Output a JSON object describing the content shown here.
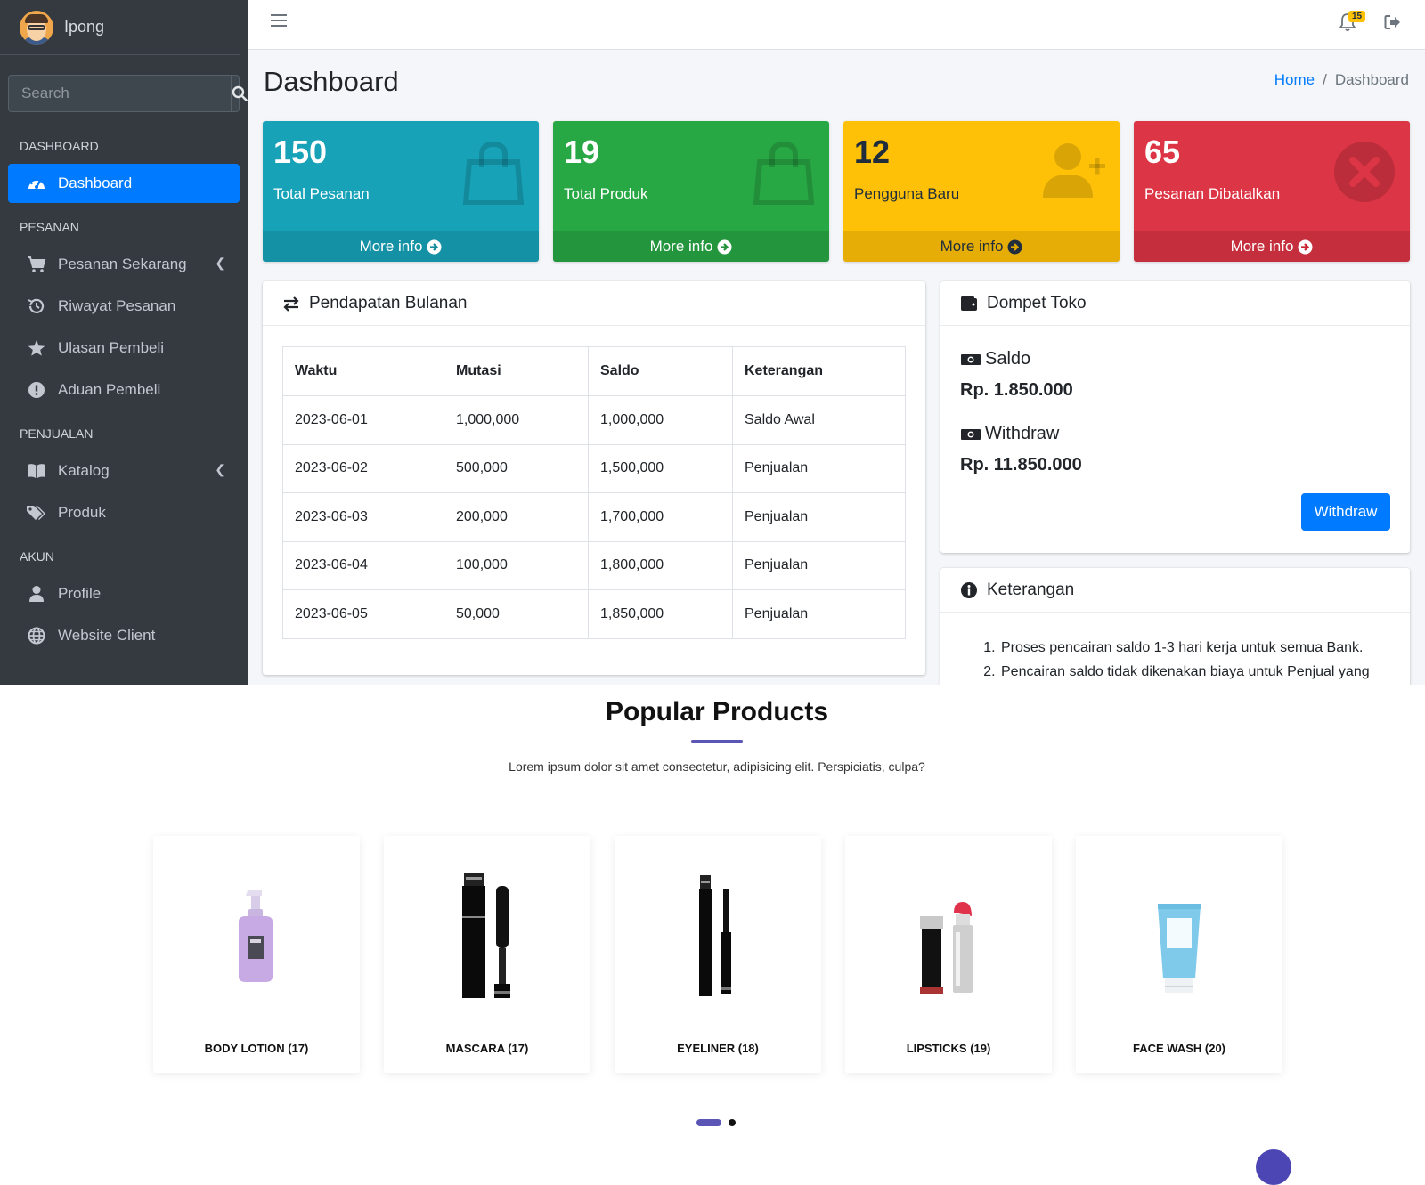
{
  "user": {
    "name": "Ipong"
  },
  "search": {
    "placeholder": "Search"
  },
  "sidebar": {
    "sections": [
      {
        "header": "DASHBOARD",
        "items": [
          {
            "label": "Dashboard",
            "icon": "tachometer-icon",
            "active": true
          }
        ]
      },
      {
        "header": "PESANAN",
        "items": [
          {
            "label": "Pesanan Sekarang",
            "icon": "cart-icon"
          },
          {
            "label": "Riwayat Pesanan",
            "icon": "history-icon"
          },
          {
            "label": "Ulasan Pembeli",
            "icon": "star-icon"
          },
          {
            "label": "Aduan Pembeli",
            "icon": "alert-icon"
          }
        ]
      },
      {
        "header": "PENJUALAN",
        "items": [
          {
            "label": "Katalog",
            "icon": "book-icon"
          },
          {
            "label": "Produk",
            "icon": "tags-icon"
          }
        ]
      },
      {
        "header": "AKUN",
        "items": [
          {
            "label": "Profile",
            "icon": "user-icon"
          },
          {
            "label": "Website Client",
            "icon": "globe-icon"
          }
        ]
      }
    ]
  },
  "topbar": {
    "notification_count": "15"
  },
  "page": {
    "title": "Dashboard"
  },
  "breadcrumb": {
    "home": "Home",
    "separator": "/",
    "current": "Dashboard"
  },
  "stats": [
    {
      "value": "150",
      "label": "Total Pesanan",
      "more": "More info",
      "color": "#17a2b8",
      "icon": "shopping-bag-icon"
    },
    {
      "value": "19",
      "label": "Total Produk",
      "more": "More info",
      "color": "#28a745",
      "icon": "shopping-bag-icon"
    },
    {
      "value": "12",
      "label": "Pengguna Baru",
      "more": "More info",
      "color": "#ffc107",
      "icon": "user-plus-icon"
    },
    {
      "value": "65",
      "label": "Pesanan Dibatalkan",
      "more": "More info",
      "color": "#dc3545",
      "icon": "times-circle-icon"
    }
  ],
  "revenue": {
    "title": "Pendapatan Bulanan",
    "columns": [
      "Waktu",
      "Mutasi",
      "Saldo",
      "Keterangan"
    ],
    "rows": [
      [
        "2023-06-01",
        "1,000,000",
        "1,000,000",
        "Saldo Awal"
      ],
      [
        "2023-06-02",
        "500,000",
        "1,500,000",
        "Penjualan"
      ],
      [
        "2023-06-03",
        "200,000",
        "1,700,000",
        "Penjualan"
      ],
      [
        "2023-06-04",
        "100,000",
        "1,800,000",
        "Penjualan"
      ],
      [
        "2023-06-05",
        "50,000",
        "1,850,000",
        "Penjualan"
      ]
    ]
  },
  "wallet": {
    "title": "Dompet Toko",
    "saldo_label": "Saldo",
    "saldo_amount": "Rp. 1.850.000",
    "withdraw_label": "Withdraw",
    "withdraw_amount": "Rp. 11.850.000",
    "withdraw_button": "Withdraw"
  },
  "notes": {
    "title": "Keterangan",
    "items": [
      "Proses pencairan saldo 1-3 hari kerja untuk semua Bank.",
      "Pencairan saldo tidak dikenakan biaya untuk Penjual yang"
    ]
  },
  "popular": {
    "title": "Popular Products",
    "subtitle": "Lorem ipsum dolor sit amet consectetur, adipisicing elit. Perspiciatis, culpa?",
    "products": [
      {
        "name": "BODY LOTION (17)",
        "icon": "lotion-bottle-icon"
      },
      {
        "name": "MASCARA (17)",
        "icon": "mascara-icon"
      },
      {
        "name": "EYELINER (18)",
        "icon": "eyeliner-icon"
      },
      {
        "name": "LIPSTICKS (19)",
        "icon": "lipstick-icon"
      },
      {
        "name": "FACE WASH (20)",
        "icon": "face-wash-tube-icon"
      }
    ]
  }
}
